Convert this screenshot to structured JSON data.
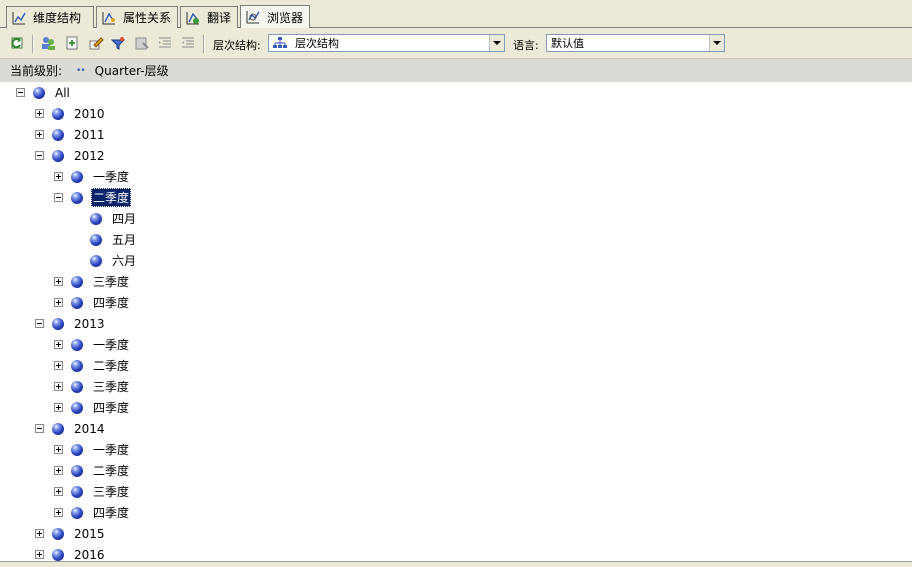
{
  "tabs": [
    {
      "label": "维度结构",
      "icon": "dimension-structure-icon",
      "active": false
    },
    {
      "label": "属性关系",
      "icon": "attribute-relationship-icon",
      "active": false
    },
    {
      "label": "翻译",
      "icon": "translation-icon",
      "active": false
    },
    {
      "label": "浏览器",
      "icon": "browser-icon",
      "active": true
    }
  ],
  "toolbar": {
    "hierarchy_label": "层次结构:",
    "hierarchy_value": "层次结构",
    "language_label": "语言:",
    "language_value": "默认值"
  },
  "level": {
    "label": "当前级别:",
    "value": "Quarter-层级"
  },
  "tree": [
    {
      "label": "All",
      "indent": 0,
      "expander": "minus",
      "selected": false
    },
    {
      "label": "2010",
      "indent": 1,
      "expander": "plus",
      "selected": false
    },
    {
      "label": "2011",
      "indent": 1,
      "expander": "plus",
      "selected": false
    },
    {
      "label": "2012",
      "indent": 1,
      "expander": "minus",
      "selected": false
    },
    {
      "label": "一季度",
      "indent": 2,
      "expander": "plus",
      "selected": false
    },
    {
      "label": "二季度",
      "indent": 2,
      "expander": "minus",
      "selected": true
    },
    {
      "label": "四月",
      "indent": 3,
      "expander": "none",
      "selected": false
    },
    {
      "label": "五月",
      "indent": 3,
      "expander": "none",
      "selected": false
    },
    {
      "label": "六月",
      "indent": 3,
      "expander": "none",
      "selected": false
    },
    {
      "label": "三季度",
      "indent": 2,
      "expander": "plus",
      "selected": false
    },
    {
      "label": "四季度",
      "indent": 2,
      "expander": "plus",
      "selected": false
    },
    {
      "label": "2013",
      "indent": 1,
      "expander": "minus",
      "selected": false
    },
    {
      "label": "一季度",
      "indent": 2,
      "expander": "plus",
      "selected": false
    },
    {
      "label": "二季度",
      "indent": 2,
      "expander": "plus",
      "selected": false
    },
    {
      "label": "三季度",
      "indent": 2,
      "expander": "plus",
      "selected": false
    },
    {
      "label": "四季度",
      "indent": 2,
      "expander": "plus",
      "selected": false
    },
    {
      "label": "2014",
      "indent": 1,
      "expander": "minus",
      "selected": false
    },
    {
      "label": "一季度",
      "indent": 2,
      "expander": "plus",
      "selected": false
    },
    {
      "label": "二季度",
      "indent": 2,
      "expander": "plus",
      "selected": false
    },
    {
      "label": "三季度",
      "indent": 2,
      "expander": "plus",
      "selected": false
    },
    {
      "label": "四季度",
      "indent": 2,
      "expander": "plus",
      "selected": false
    },
    {
      "label": "2015",
      "indent": 1,
      "expander": "plus",
      "selected": false
    },
    {
      "label": "2016",
      "indent": 1,
      "expander": "plus",
      "selected": false
    }
  ]
}
